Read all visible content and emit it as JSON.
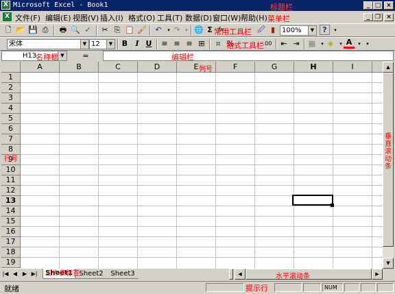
{
  "title_bar": {
    "app_icon": "excel-icon",
    "title": "Microsoft Excel - Book1",
    "annotation": "标题栏",
    "btn_min": "_",
    "btn_max": "□",
    "btn_close": "×"
  },
  "menu_bar": {
    "items": [
      "文件(F)",
      "编辑(E)",
      "视图(V)",
      "插入(I)",
      "格式(O)",
      "工具(T)",
      "数据(D)",
      "窗口(W)",
      "帮助(H)"
    ],
    "annotation": "菜单栏",
    "doc_btn_min": "_",
    "doc_btn_restore": "❐",
    "doc_btn_close": "×"
  },
  "standard_toolbar": {
    "annotation": "常用工具栏",
    "zoom": "100%",
    "sigma": "Σ",
    "fx": "fx",
    "help": "?"
  },
  "format_toolbar": {
    "annotation": "格式工具栏",
    "font": "宋体",
    "size": "12",
    "bold": "B",
    "italic": "I",
    "underline": "U",
    "currency": "%",
    "decimal": ".00"
  },
  "formula_bar": {
    "name_box": "H13",
    "name_box_annotation": "名称框",
    "equals": "=",
    "formula": "",
    "annotation": "编辑栏"
  },
  "sheet": {
    "columns": [
      "A",
      "B",
      "C",
      "D",
      "E",
      "F",
      "G",
      "H",
      "I"
    ],
    "rows": [
      "1",
      "2",
      "3",
      "4",
      "5",
      "6",
      "7",
      "8",
      "9",
      "10",
      "11",
      "12",
      "13",
      "14",
      "15",
      "16",
      "17",
      "18",
      "19"
    ],
    "active_cell": "H13",
    "col_annotation": "列号",
    "row_annotation": "行号"
  },
  "vertical_scroll": {
    "annotation": "垂直滚动条",
    "up": "▲",
    "down": "▼"
  },
  "sheet_tabs": {
    "tabs": [
      "Sheet1",
      "Sheet2",
      "Sheet3"
    ],
    "active": "Sheet1",
    "annotation": "工作表标签",
    "nav": [
      "|◀",
      "◀",
      "▶",
      "▶|"
    ]
  },
  "horizontal_scroll": {
    "annotation": "水平滚动条",
    "left": "◀",
    "right": "▶"
  },
  "status_bar": {
    "text": "就绪",
    "annotation": "提示行",
    "num": "NUM"
  },
  "colors": {
    "title_bar": "#0a246a",
    "annotation": "#ff0000",
    "face": "#d4d0c8"
  }
}
